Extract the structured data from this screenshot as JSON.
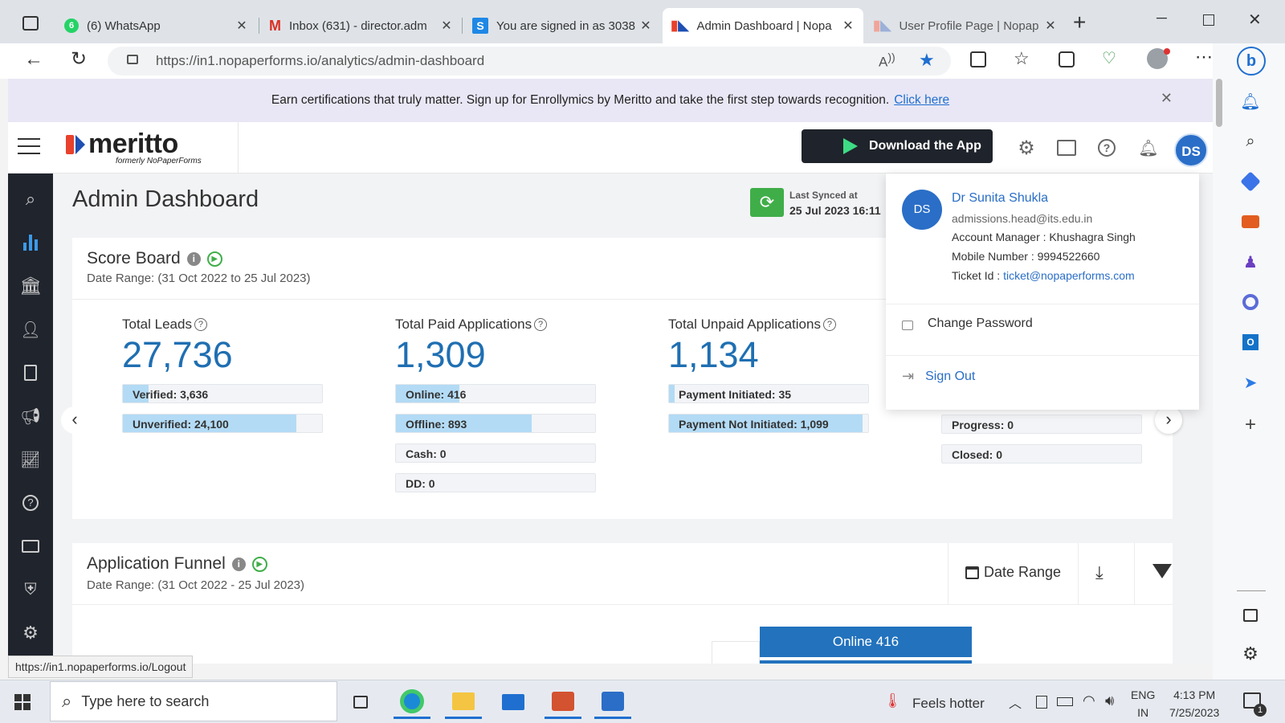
{
  "browser": {
    "tabs": [
      {
        "title": "(6) WhatsApp",
        "icon": "whatsapp-icon"
      },
      {
        "title": "Inbox (631) - director.adm",
        "icon": "gmail-icon"
      },
      {
        "title": "You are signed in as 3038",
        "icon": "s-icon"
      },
      {
        "title": "Admin Dashboard | Nopa",
        "icon": "meritto-icon",
        "active": true
      },
      {
        "title": "User Profile Page | Nopap",
        "icon": "meritto-icon"
      }
    ],
    "url": "https://in1.nopaperforms.io/analytics/admin-dashboard",
    "whatsapp_badge": "6"
  },
  "banner": {
    "text": "Earn certifications that truly matter. Sign up for Enrollymics by Meritto and take the first step towards recognition.",
    "link": "Click here"
  },
  "header": {
    "logo": "meritto",
    "logo_sub": "formerly NoPaperForms",
    "download_label": "Download the App",
    "avatar_initials": "DS"
  },
  "page": {
    "title": "Admin Dashboard",
    "sync_label": "Last Synced at",
    "sync_time": "25 Jul 2023 16:11"
  },
  "scoreboard": {
    "title": "Score Board",
    "date_range": "Date Range: (31 Oct 2022 to 25 Jul 2023)",
    "stats": [
      {
        "label": "Total Leads",
        "value": "27,736",
        "bars": [
          {
            "label": "Verified: 3,636",
            "fill": 0.13
          },
          {
            "label": "Unverified: 24,100",
            "fill": 0.87
          }
        ]
      },
      {
        "label": "Total Paid Applications",
        "value": "1,309",
        "bars": [
          {
            "label": "Online: 416",
            "fill": 0.32
          },
          {
            "label": "Offline: 893",
            "fill": 0.68
          },
          {
            "label": "Cash: 0",
            "fill": 0
          },
          {
            "label": "DD: 0",
            "fill": 0
          }
        ]
      },
      {
        "label": "Total Unpaid Applications",
        "value": "1,134",
        "bars": [
          {
            "label": "Payment Initiated: 35",
            "fill": 0.03
          },
          {
            "label": "Payment Not Initiated: 1,099",
            "fill": 0.97
          }
        ]
      },
      {
        "label": "",
        "value": "",
        "bars": [
          {
            "label": "Progress: 0",
            "fill": 0
          },
          {
            "label": "Closed: 0",
            "fill": 0
          }
        ]
      }
    ]
  },
  "funnel": {
    "title": "Application Funnel",
    "date_range": "Date Range: (31 Oct 2022 - 25 Jul 2023)",
    "date_range_btn": "Date Range",
    "bar_label": "Online 416"
  },
  "profile": {
    "initials": "DS",
    "name": "Dr Sunita Shukla",
    "email": "admissions.head@its.edu.in",
    "account_manager_label": "Account Manager :",
    "account_manager": "Khushagra Singh",
    "mobile_label": "Mobile Number :",
    "mobile": "9994522660",
    "ticket_label": "Ticket Id :",
    "ticket": "ticket@nopaperforms.com",
    "change_password": "Change Password",
    "sign_out": "Sign Out"
  },
  "status_url": "https://in1.nopaperforms.io/Logout",
  "taskbar": {
    "search_placeholder": "Type here to search",
    "weather": "Feels hotter",
    "lang": "ENG",
    "region": "IN",
    "time": "4:13 PM",
    "date": "7/25/2023",
    "notif_count": "1"
  },
  "colors": {
    "accent": "#1f6fb2",
    "nav_dark": "#20242d",
    "fill_blue": "#b3dbf5",
    "brand_red": "#e8412c"
  }
}
